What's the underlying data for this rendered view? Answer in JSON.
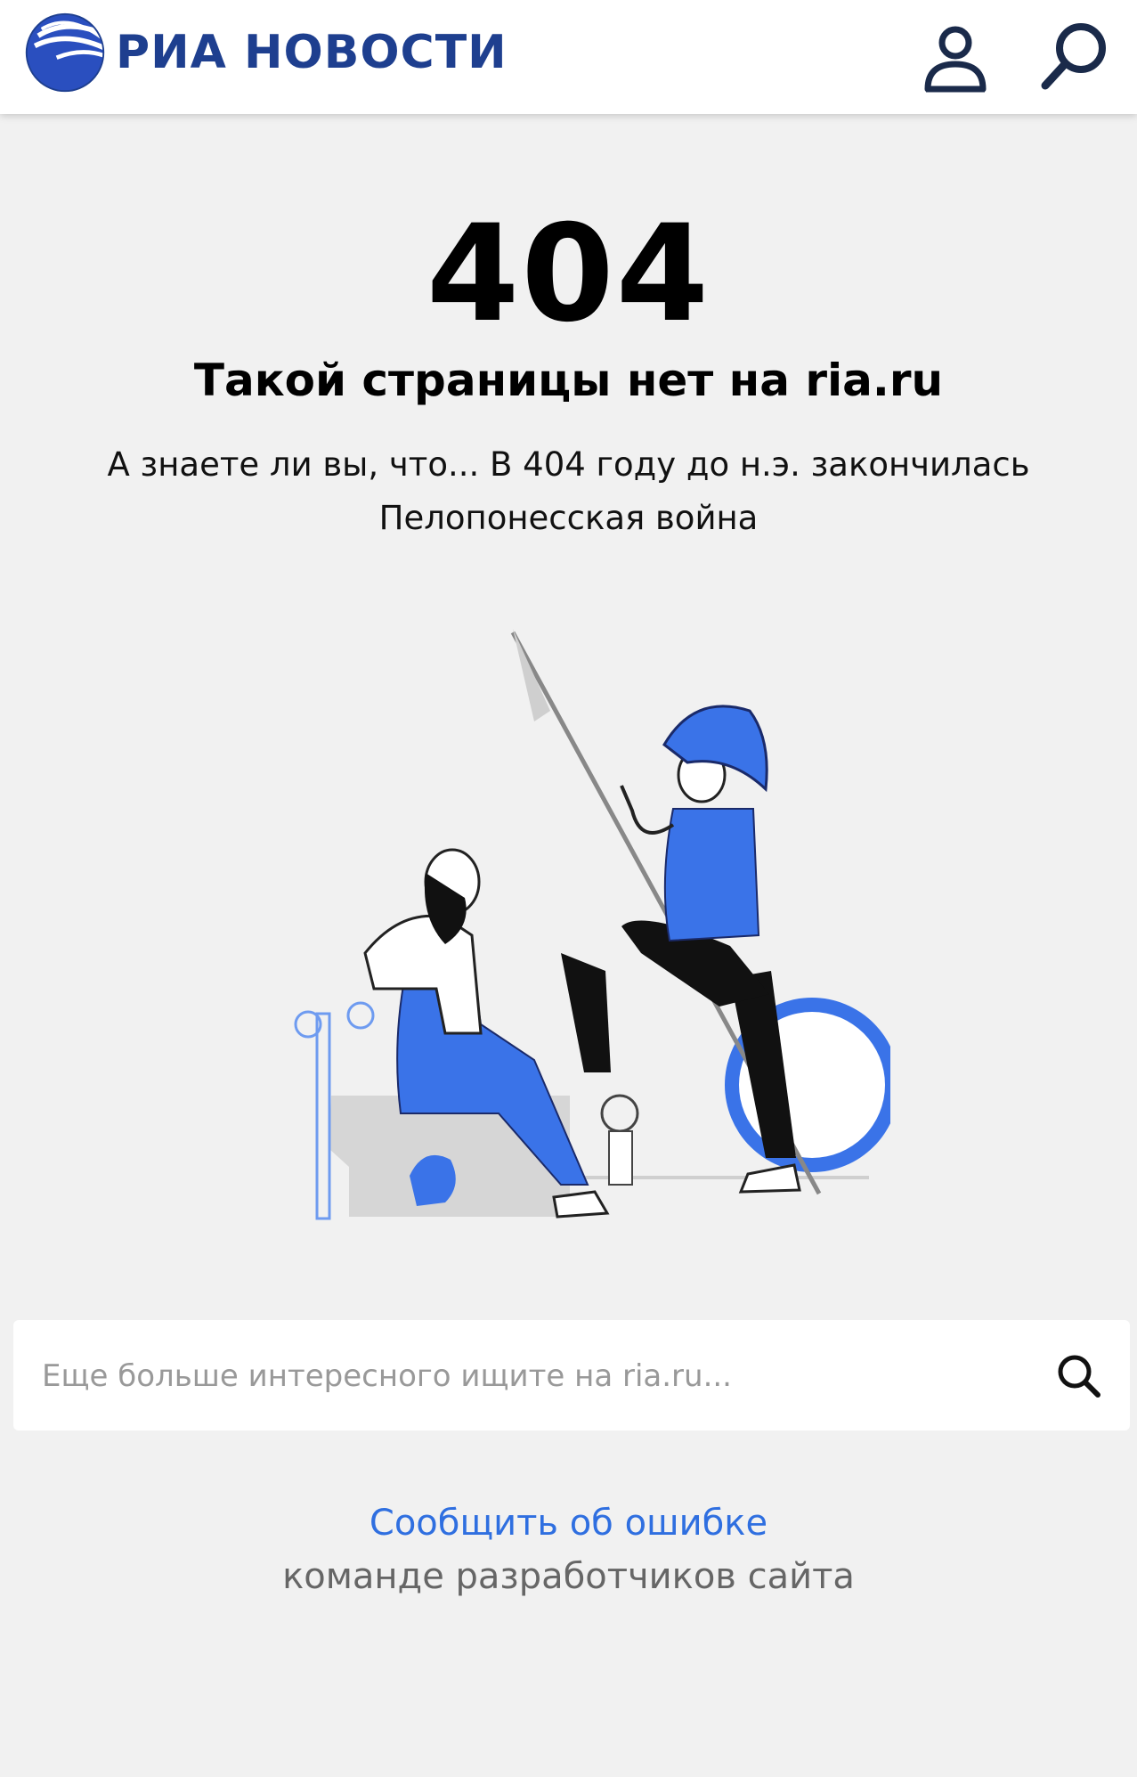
{
  "header": {
    "logo_text": "РИА НОВОСТИ",
    "logo_icon": "ria-globe-icon",
    "user_icon": "user-icon",
    "search_icon": "search-icon"
  },
  "error": {
    "code": "404",
    "title": "Такой страницы нет на ria.ru",
    "fact": "А знаете ли вы, что... В 404 году до н.э. закончилась Пелопонесская война"
  },
  "search": {
    "placeholder": "Еще больше интересного ищите на ria.ru...",
    "value": ""
  },
  "report": {
    "link_label": "Сообщить об ошибке",
    "sub_label": "команде разработчиков сайта"
  },
  "colors": {
    "brand": "#1e3f8f",
    "accent_blue": "#3a73e8",
    "link": "#2f6fe0",
    "background": "#f1f1f1"
  }
}
